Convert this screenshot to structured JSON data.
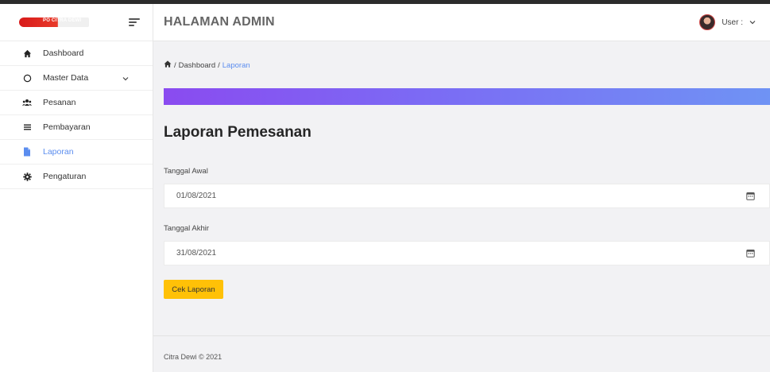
{
  "brand": {
    "logo_text": "PO CITRA DEWI",
    "logo_colors": {
      "primary": "#d81a1a"
    }
  },
  "header": {
    "title": "HALAMAN ADMIN",
    "user_label": "User :",
    "user_dropdown_icon": "chevron-down-icon"
  },
  "sidebar": {
    "items": [
      {
        "label": "Dashboard",
        "icon": "home-icon",
        "active": false
      },
      {
        "label": "Master Data",
        "icon": "circle-icon",
        "active": false,
        "has_submenu": true
      },
      {
        "label": "Pesanan",
        "icon": "users-icon",
        "active": false
      },
      {
        "label": "Pembayaran",
        "icon": "list-icon",
        "active": false
      },
      {
        "label": "Laporan",
        "icon": "file-icon",
        "active": true
      },
      {
        "label": "Pengaturan",
        "icon": "gear-icon",
        "active": false
      }
    ]
  },
  "breadcrumb": {
    "home_icon": "home-icon",
    "sep1": "/",
    "item1": "Dashboard",
    "sep2": "/",
    "item2": "Laporan"
  },
  "main": {
    "page_title": "Laporan Pemesanan",
    "start_date": {
      "label": "Tanggal Awal",
      "value": "01/08/2021",
      "icon": "calendar-icon"
    },
    "end_date": {
      "label": "Tanggal Akhir",
      "value": "31/08/2021",
      "icon": "calendar-icon"
    },
    "submit_label": "Cek Laporan"
  },
  "footer": {
    "text": "Citra Dewi © 2021"
  },
  "colors": {
    "accent": "#5b8def",
    "banner_start": "#8a4bf0",
    "banner_end": "#6f93f4",
    "button": "#ffc107",
    "background": "#f2f2f4"
  }
}
